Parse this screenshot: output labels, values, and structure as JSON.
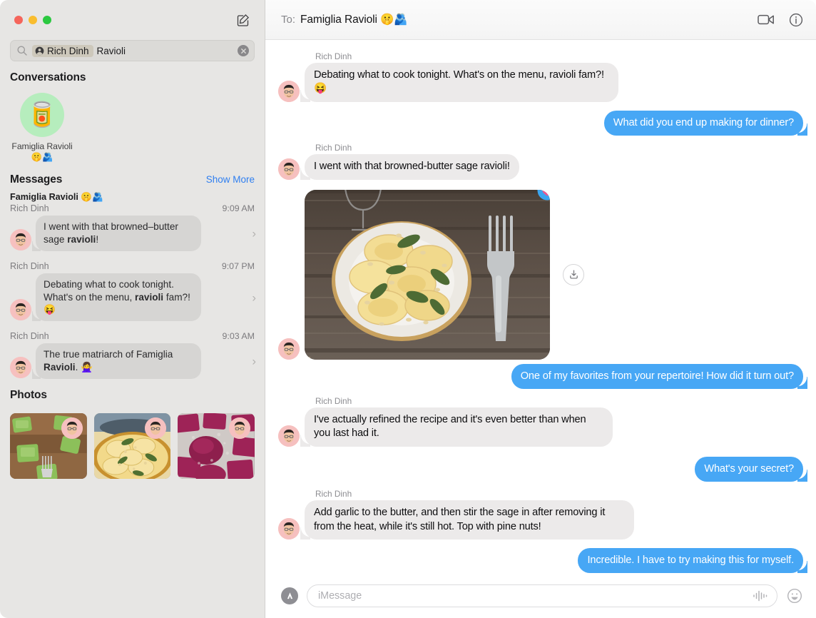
{
  "window": {
    "traffic_lights": [
      "close",
      "minimize",
      "zoom"
    ],
    "compose_icon": "compose-icon"
  },
  "search": {
    "icon": "search-icon",
    "token_label": "Rich Dinh",
    "token_icon": "person-circle-icon",
    "query_text": "Ravioli",
    "clear_icon": "clear-icon"
  },
  "sidebar": {
    "conversations": {
      "title": "Conversations",
      "items": [
        {
          "name": "Famiglia Ravioli 🤫🫂",
          "avatar_emoji": "🥫",
          "avatar_bg": "#b6edbd"
        }
      ]
    },
    "messages": {
      "title": "Messages",
      "show_more": "Show More",
      "results": [
        {
          "conversation": "Famiglia Ravioli 🤫🫂",
          "sender": "Rich Dinh",
          "time": "9:09 AM",
          "text_before": "I went with that browned–butter sage ",
          "text_match": "ravioli",
          "text_after": "!",
          "chevron": "chevron-right-icon"
        },
        {
          "conversation": "",
          "sender": "Rich Dinh",
          "time": "9:07 PM",
          "text_before": "Debating what to cook tonight. What's on the menu, ",
          "text_match": "ravioli",
          "text_after": " fam?! 😝",
          "chevron": "chevron-right-icon"
        },
        {
          "conversation": "",
          "sender": "Rich Dinh",
          "time": "9:03 AM",
          "text_before": "The true matriarch of Famiglia ",
          "text_match": "Ravioli",
          "text_after": ". 🙅‍♀️",
          "chevron": "chevron-right-icon"
        }
      ]
    },
    "photos": {
      "title": "Photos",
      "items": [
        {
          "alt": "green spinach ravioli on wooden board with fork"
        },
        {
          "alt": "yellow ravioli with sage and pine nuts on plate"
        },
        {
          "alt": "magenta beet ravioli dusted with flour"
        }
      ]
    }
  },
  "chat": {
    "header": {
      "to_label": "To:",
      "recipient": "Famiglia Ravioli 🤫🫂",
      "facetime_icon": "video-camera-icon",
      "info_icon": "info-circle-icon"
    },
    "messages": [
      {
        "id": "m1",
        "direction": "in",
        "sender": "Rich Dinh",
        "text": "Debating what to cook tonight. What's on the menu, ravioli fam?! 😝"
      },
      {
        "id": "m2",
        "direction": "out",
        "sender": "",
        "text": "What did you end up making for dinner?"
      },
      {
        "id": "m3",
        "direction": "in",
        "sender": "Rich Dinh",
        "text": "I went with that browned-butter sage ravioli!"
      },
      {
        "id": "m4",
        "direction": "in",
        "type": "image",
        "sender": "",
        "alt": "Plate of ravioli with crispy sage and pine nuts on a dark wooden table with a fork and wine glass",
        "reaction": "heart",
        "download_icon": "download-icon"
      },
      {
        "id": "m5",
        "direction": "out",
        "sender": "",
        "text": "One of my favorites from your repertoire! How did it turn out?"
      },
      {
        "id": "m6",
        "direction": "in",
        "sender": "Rich Dinh",
        "text": "I've actually refined the recipe and it's even better than when you last had it."
      },
      {
        "id": "m7",
        "direction": "out",
        "sender": "",
        "text": "What's your secret?"
      },
      {
        "id": "m8",
        "direction": "in",
        "sender": "Rich Dinh",
        "text": "Add garlic to the butter, and then stir the sage in after removing it from the heat, while it's still hot. Top with pine nuts!"
      },
      {
        "id": "m9",
        "direction": "out",
        "sender": "",
        "text": "Incredible. I have to try making this for myself."
      }
    ],
    "composer": {
      "apps_icon": "app-store-icon",
      "placeholder": "iMessage",
      "value": "",
      "audio_icon": "audio-waveform-icon",
      "emoji_icon": "smiley-icon"
    }
  },
  "colors": {
    "bubble_blue": "#47a7f5",
    "bubble_gray": "#eceaea",
    "sidebar_bg": "#e7e6e4",
    "link_blue": "#2f7ff0",
    "reaction_blue": "#3aa5f0",
    "reaction_heart": "#f0568f"
  }
}
